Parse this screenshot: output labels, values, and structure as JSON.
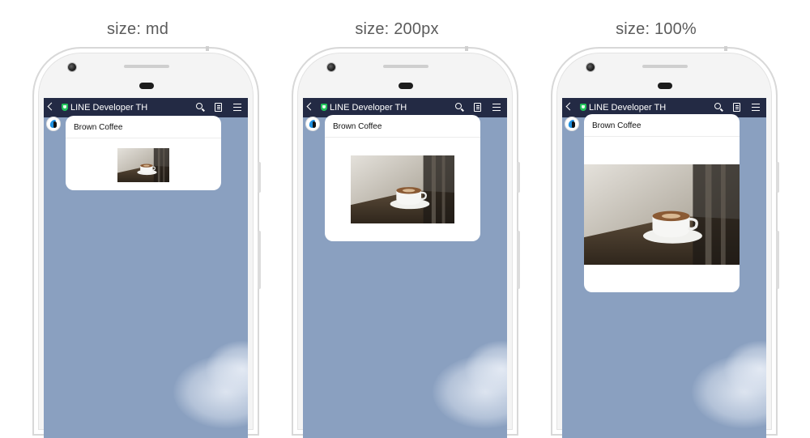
{
  "panels": [
    {
      "caption": "size: md"
    },
    {
      "caption": "size: 200px"
    },
    {
      "caption": "size: 100%"
    }
  ],
  "chat": {
    "title": "LINE Developer TH",
    "header_color": "#232a44",
    "background_color": "#8aa0c0",
    "verified_color": "#21c35a"
  },
  "bubble": {
    "title": "Brown Coffee"
  },
  "icons": {
    "back": "back-chevron-icon",
    "verified": "verified-shield-icon",
    "search": "search-icon",
    "notes": "notes-icon",
    "menu": "menu-icon",
    "avatar": "line-developer-avatar-icon"
  }
}
